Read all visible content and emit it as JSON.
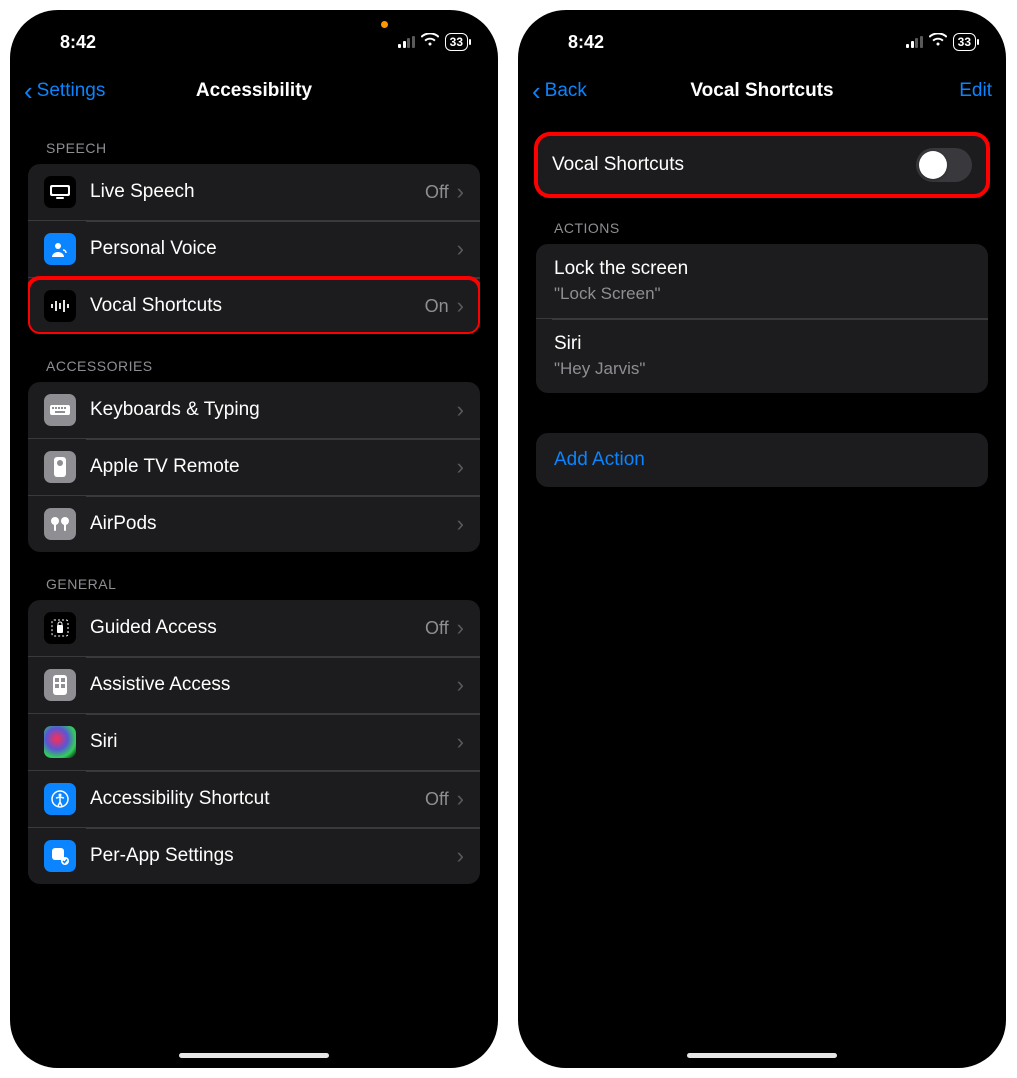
{
  "status": {
    "time": "8:42",
    "battery": "33"
  },
  "left": {
    "nav": {
      "back": "Settings",
      "title": "Accessibility"
    },
    "sections": {
      "speech": {
        "header": "SPEECH",
        "rows": [
          {
            "label": "Live Speech",
            "value": "Off",
            "icon": "live-speech"
          },
          {
            "label": "Personal Voice",
            "value": "",
            "icon": "personal-voice"
          },
          {
            "label": "Vocal Shortcuts",
            "value": "On",
            "icon": "vocal-shortcuts"
          }
        ]
      },
      "accessories": {
        "header": "ACCESSORIES",
        "rows": [
          {
            "label": "Keyboards & Typing",
            "icon": "keyboard"
          },
          {
            "label": "Apple TV Remote",
            "icon": "remote"
          },
          {
            "label": "AirPods",
            "icon": "airpods"
          }
        ]
      },
      "general": {
        "header": "GENERAL",
        "rows": [
          {
            "label": "Guided Access",
            "value": "Off",
            "icon": "guided-access"
          },
          {
            "label": "Assistive Access",
            "value": "",
            "icon": "assistive-access"
          },
          {
            "label": "Siri",
            "value": "",
            "icon": "siri"
          },
          {
            "label": "Accessibility Shortcut",
            "value": "Off",
            "icon": "a11y-shortcut"
          },
          {
            "label": "Per-App Settings",
            "value": "",
            "icon": "per-app"
          }
        ]
      }
    }
  },
  "right": {
    "nav": {
      "back": "Back",
      "title": "Vocal Shortcuts",
      "edit": "Edit"
    },
    "toggle": {
      "label": "Vocal Shortcuts",
      "on": false
    },
    "actions": {
      "header": "ACTIONS",
      "rows": [
        {
          "title": "Lock the screen",
          "phrase": "\"Lock Screen\""
        },
        {
          "title": "Siri",
          "phrase": "\"Hey Jarvis\""
        }
      ]
    },
    "addAction": "Add Action"
  }
}
